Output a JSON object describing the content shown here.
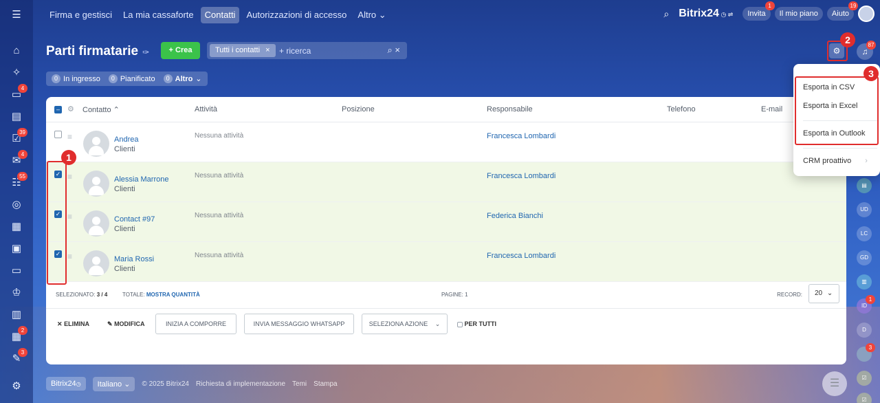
{
  "colors": {
    "accent": "#2066b0",
    "create_button": "#3bc34a",
    "highlight": "#e02d2d",
    "selected_row": "#f1f8e6"
  },
  "topnav": {
    "items": [
      "Firma e gestisci",
      "La mia cassaforte",
      "Contatti",
      "Autorizzazioni di accesso",
      "Altro"
    ],
    "active_index": 2,
    "brand": "Bitrix24",
    "invite": "Invita",
    "invite_badge": "1",
    "plan": "Il mio piano",
    "help": "Aiuto",
    "help_badge": "19"
  },
  "leftbar": {
    "badges": {
      "chat": "4",
      "tasks": "39",
      "mail": "4",
      "feed": "55",
      "calendar_tasks": "2",
      "reports": "3"
    }
  },
  "header": {
    "title": "Parti firmatarie",
    "create_label": "+ Crea",
    "filter_chip": "Tutti i contatti",
    "search_placeholder": "+ ricerca",
    "notifications_badge": "87"
  },
  "counters": [
    {
      "count": "0",
      "label": "In ingresso"
    },
    {
      "count": "0",
      "label": "Pianificato"
    },
    {
      "count": "0",
      "label": "Altro"
    }
  ],
  "table": {
    "columns": [
      "Contatto",
      "Attività",
      "Posizione",
      "Responsabile",
      "Telefono",
      "E-mail"
    ],
    "rows": [
      {
        "name": "Andrea",
        "type": "Clienti",
        "activity": "Nessuna attività",
        "responsible": "Francesca Lombardi",
        "selected": false
      },
      {
        "name": "Alessia Marrone",
        "type": "Clienti",
        "activity": "Nessuna attività",
        "responsible": "Francesca Lombardi",
        "selected": true
      },
      {
        "name": "Contact #97",
        "type": "Clienti",
        "activity": "Nessuna attività",
        "responsible": "Federica Bianchi",
        "selected": true
      },
      {
        "name": "Maria Rossi",
        "type": "Clienti",
        "activity": "Nessuna attività",
        "responsible": "Francesca Lombardi",
        "selected": true
      }
    ]
  },
  "footer": {
    "selected_label": "SELEZIONATO:",
    "selected_value": "3 / 4",
    "total_label": "TOTALE:",
    "total_link": "MOSTRA QUANTITÀ",
    "pages_label": "PAGINE: 1",
    "record_label": "RECORD:",
    "record_value": "20"
  },
  "actions": {
    "delete": "ELIMINA",
    "edit": "MODIFICA",
    "start_compose": "INIZIA A COMPORRE",
    "whatsapp": "INVIA MESSAGGIO WHATSAPP",
    "select_action": "SELEZIONA AZIONE",
    "for_all": "PER TUTTI"
  },
  "menu": {
    "items": [
      "Esporta in CSV",
      "Esporta in Excel",
      "Esporta in Outlook",
      "CRM proattivo"
    ]
  },
  "annotations": [
    "1",
    "2",
    "3"
  ],
  "rightbar": {
    "avatars": [
      "UD",
      "LC",
      "GD",
      "ID",
      "D"
    ],
    "id_badge": "1",
    "bottom_badge": "3"
  },
  "bottombar": {
    "brand": "Bitrix24",
    "language": "Italiano",
    "copyright": "© 2025 Bitrix24",
    "links": [
      "Richiesta di implementazione",
      "Temi",
      "Stampa"
    ]
  }
}
